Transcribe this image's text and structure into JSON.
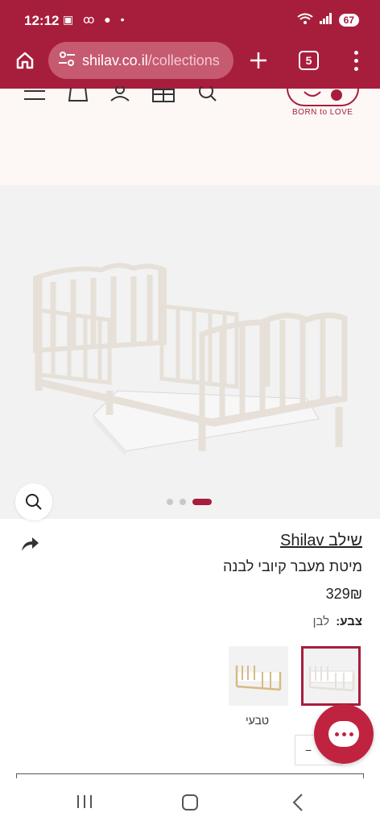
{
  "status_bar": {
    "time": "12:12",
    "battery": "67"
  },
  "browser": {
    "url_host": "shilav.co.il",
    "url_path": "/collections",
    "tab_count": "5"
  },
  "logo": {
    "tagline": "BORN to LOVE"
  },
  "gallery": {
    "image_count": 3,
    "active_index": 2
  },
  "product": {
    "brand": "שילב Shilav",
    "title": "מיטת מעבר קיובי לבנה",
    "price": "329₪",
    "color_label": "צבע:",
    "color_value": "לבן",
    "variants": [
      {
        "label": "",
        "selected": true,
        "finish": "#efeae6"
      },
      {
        "label": "טבעי",
        "selected": false,
        "finish": "#d9b985"
      }
    ],
    "qty_symbol": "−"
  },
  "colors": {
    "brand": "#a71e3c",
    "chat": "#c0233f"
  }
}
